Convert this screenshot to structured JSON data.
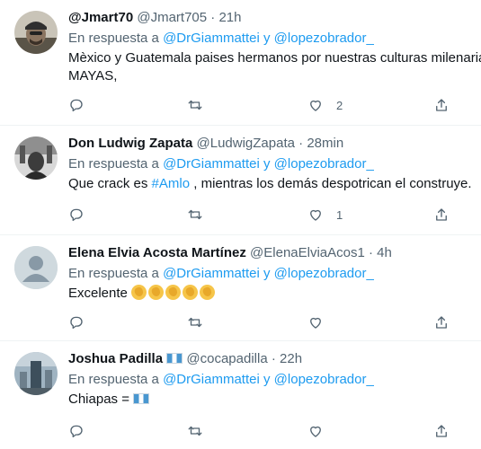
{
  "tweets": [
    {
      "name": "@Jmart70",
      "handle": "@Jmart705",
      "dot": "·",
      "time": "21h",
      "reply_prefix": "En respuesta a",
      "mention1": "@DrGiammattei",
      "reply_and": "y",
      "mention2": "@lopezobrador_",
      "text_line1": "Mèxico y Guatemala paises hermanos por nuestras culturas milenarias,",
      "text_line2": "MAYAS,",
      "likes": "2",
      "avatar_color": "#6b6355"
    },
    {
      "name": "Don Ludwig Zapata",
      "handle": "@LudwigZapata",
      "dot": "·",
      "time": "28min",
      "reply_prefix": "En respuesta a",
      "mention1": "@DrGiammattei",
      "reply_and": "y",
      "mention2": "@lopezobrador_",
      "text_before": "Que crack es",
      "hashtag": "#Amlo",
      "text_after": ", mientras los demás despotrican el construye.",
      "likes": "1",
      "avatar_color": "#4a4a4a"
    },
    {
      "name": "Elena Elvia Acosta Martínez",
      "handle": "@ElenaElviaAcos1",
      "dot": "·",
      "time": "4h",
      "reply_prefix": "En respuesta a",
      "mention1": "@DrGiammattei",
      "reply_and": "y",
      "mention2": "@lopezobrador_",
      "text": "Excelente",
      "emoji": "clapping-hands x5",
      "avatar_color": "#cfd9de"
    },
    {
      "name": "Joshua Padilla",
      "handle": "@cocapadilla",
      "dot": "·",
      "time": "22h",
      "reply_prefix": "En respuesta a",
      "mention1": "@DrGiammattei",
      "reply_and": "y",
      "mention2": "@lopezobrador_",
      "text": "Chiapas =",
      "emoji": "guatemala-flag",
      "avatar_color": "#5d7a8c"
    }
  ],
  "colors": {
    "link": "#1d9bf0",
    "secondary_text": "#536471",
    "primary_text": "#0f1419",
    "divider": "#eff3f4"
  },
  "icons": [
    "reply-icon",
    "retweet-icon",
    "like-icon",
    "share-icon"
  ]
}
